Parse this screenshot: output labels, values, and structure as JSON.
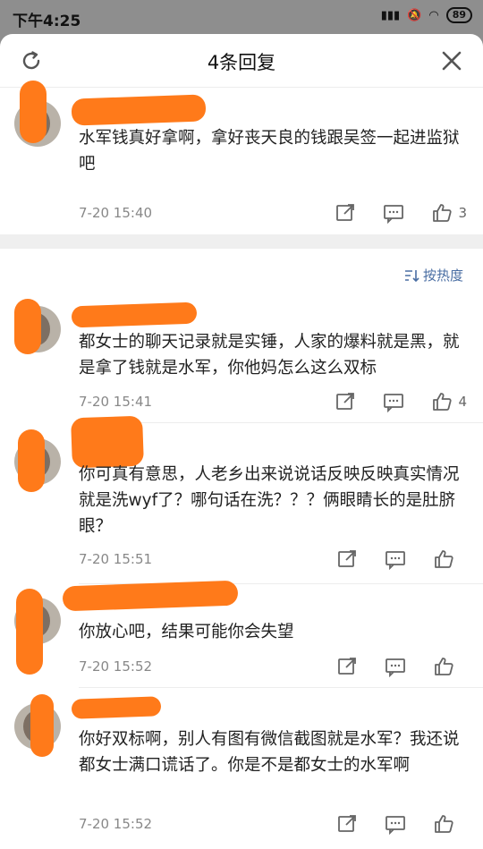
{
  "status_bar": {
    "time": "下午4:25",
    "battery": "89"
  },
  "header": {
    "title": "4条回复"
  },
  "sort_label": "按热度",
  "comments": [
    {
      "text": "水军钱真好拿啊，拿好丧天良的钱跟吴签一起进监狱吧",
      "time": "7-20 15:40",
      "likes": "3"
    },
    {
      "text": "都女士的聊天记录就是实锤，人家的爆料就是黑，就是拿了钱就是水军，你他妈怎么这么双标",
      "time": "7-20 15:41",
      "likes": "4"
    },
    {
      "text": "你可真有意思，人老乡出来说说话反映反映真实情况就是洗wyf了？哪句话在洗？？？俩眼睛长的是肚脐眼？",
      "time": "7-20 15:51",
      "likes": ""
    },
    {
      "text": "你放心吧，结果可能你会失望",
      "time": "7-20 15:52",
      "likes": ""
    },
    {
      "text": "你好双标啊，别人有图有微信截图就是水军？我还说都女士满口谎话了。你是不是都女士的水军啊",
      "time": "7-20 15:52",
      "likes": ""
    }
  ],
  "colors": {
    "accent": "#4a6ea3",
    "redaction": "#ff7a1a"
  }
}
